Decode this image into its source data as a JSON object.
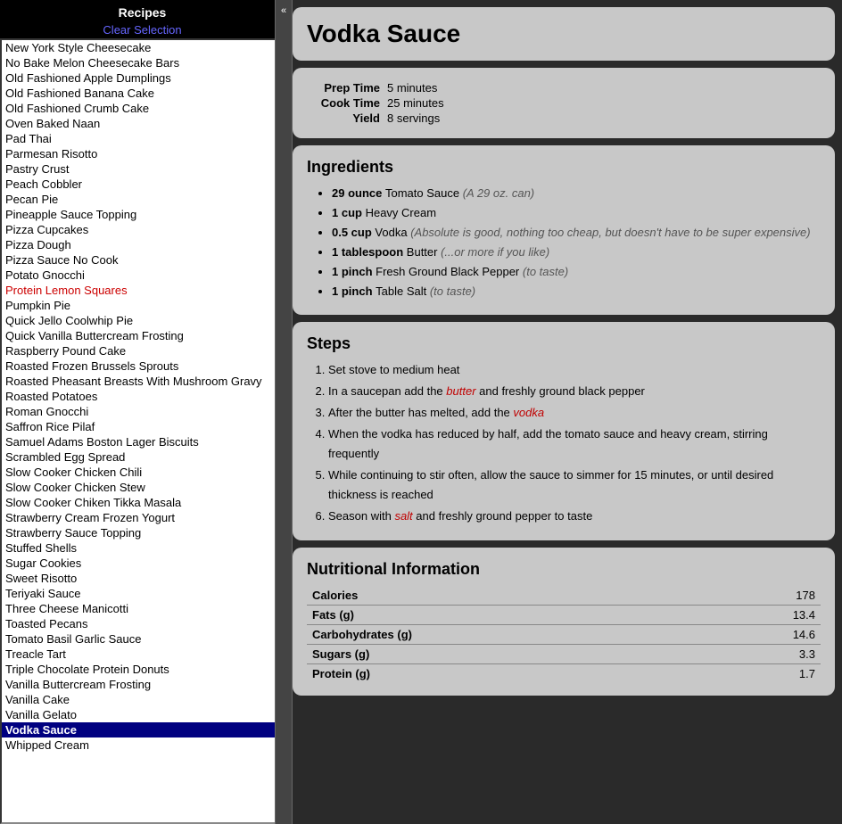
{
  "sidebar": {
    "title": "Recipes",
    "clear_label": "Clear Selection",
    "collapse_icon": "«",
    "recipes": [
      {
        "name": "New York Style Cheesecake",
        "selected": false,
        "red": false
      },
      {
        "name": "No Bake Melon Cheesecake Bars",
        "selected": false,
        "red": false
      },
      {
        "name": "Old Fashioned Apple Dumplings",
        "selected": false,
        "red": false
      },
      {
        "name": "Old Fashioned Banana Cake",
        "selected": false,
        "red": false
      },
      {
        "name": "Old Fashioned Crumb Cake",
        "selected": false,
        "red": false
      },
      {
        "name": "Oven Baked Naan",
        "selected": false,
        "red": false
      },
      {
        "name": "Pad Thai",
        "selected": false,
        "red": false
      },
      {
        "name": "Parmesan Risotto",
        "selected": false,
        "red": false
      },
      {
        "name": "Pastry Crust",
        "selected": false,
        "red": false
      },
      {
        "name": "Peach Cobbler",
        "selected": false,
        "red": false
      },
      {
        "name": "Pecan Pie",
        "selected": false,
        "red": false
      },
      {
        "name": "Pineapple Sauce Topping",
        "selected": false,
        "red": false
      },
      {
        "name": "Pizza Cupcakes",
        "selected": false,
        "red": false
      },
      {
        "name": "Pizza Dough",
        "selected": false,
        "red": false
      },
      {
        "name": "Pizza Sauce No Cook",
        "selected": false,
        "red": false
      },
      {
        "name": "Potato Gnocchi",
        "selected": false,
        "red": false
      },
      {
        "name": "Protein Lemon Squares",
        "selected": false,
        "red": true
      },
      {
        "name": "Pumpkin Pie",
        "selected": false,
        "red": false
      },
      {
        "name": "Quick Jello Coolwhip Pie",
        "selected": false,
        "red": false
      },
      {
        "name": "Quick Vanilla Buttercream Frosting",
        "selected": false,
        "red": false
      },
      {
        "name": "Raspberry Pound Cake",
        "selected": false,
        "red": false
      },
      {
        "name": "Roasted Frozen Brussels Sprouts",
        "selected": false,
        "red": false
      },
      {
        "name": "Roasted Pheasant Breasts With Mushroom Gravy",
        "selected": false,
        "red": false
      },
      {
        "name": "Roasted Potatoes",
        "selected": false,
        "red": false
      },
      {
        "name": "Roman Gnocchi",
        "selected": false,
        "red": false
      },
      {
        "name": "Saffron Rice Pilaf",
        "selected": false,
        "red": false
      },
      {
        "name": "Samuel Adams Boston Lager Biscuits",
        "selected": false,
        "red": false
      },
      {
        "name": "Scrambled Egg Spread",
        "selected": false,
        "red": false
      },
      {
        "name": "Slow Cooker Chicken Chili",
        "selected": false,
        "red": false
      },
      {
        "name": "Slow Cooker Chicken Stew",
        "selected": false,
        "red": false
      },
      {
        "name": "Slow Cooker Chiken Tikka Masala",
        "selected": false,
        "red": false
      },
      {
        "name": "Strawberry Cream Frozen Yogurt",
        "selected": false,
        "red": false
      },
      {
        "name": "Strawberry Sauce Topping",
        "selected": false,
        "red": false
      },
      {
        "name": "Stuffed Shells",
        "selected": false,
        "red": false
      },
      {
        "name": "Sugar Cookies",
        "selected": false,
        "red": false
      },
      {
        "name": "Sweet Risotto",
        "selected": false,
        "red": false
      },
      {
        "name": "Teriyaki Sauce",
        "selected": false,
        "red": false
      },
      {
        "name": "Three Cheese Manicotti",
        "selected": false,
        "red": false
      },
      {
        "name": "Toasted Pecans",
        "selected": false,
        "red": false
      },
      {
        "name": "Tomato Basil Garlic Sauce",
        "selected": false,
        "red": false
      },
      {
        "name": "Treacle Tart",
        "selected": false,
        "red": false
      },
      {
        "name": "Triple Chocolate Protein Donuts",
        "selected": false,
        "red": false
      },
      {
        "name": "Vanilla Buttercream Frosting",
        "selected": false,
        "red": false
      },
      {
        "name": "Vanilla Cake",
        "selected": false,
        "red": false
      },
      {
        "name": "Vanilla Gelato",
        "selected": false,
        "red": false
      },
      {
        "name": "Vodka Sauce",
        "selected": true,
        "red": false
      },
      {
        "name": "Whipped Cream",
        "selected": false,
        "red": false
      }
    ]
  },
  "recipe": {
    "title": "Vodka Sauce",
    "prep_time_label": "Prep Time",
    "prep_time": "5 minutes",
    "cook_time_label": "Cook Time",
    "cook_time": "25 minutes",
    "yield_label": "Yield",
    "yield": "8 servings",
    "ingredients_title": "Ingredients",
    "ingredients": [
      {
        "amount": "29 ounce",
        "name": "Tomato Sauce",
        "note": "(A 29 oz. can)"
      },
      {
        "amount": "1 cup",
        "name": "Heavy Cream",
        "note": ""
      },
      {
        "amount": "0.5 cup",
        "name": "Vodka",
        "note": "(Absolute is good, nothing too cheap, but doesn't have to be super expensive)"
      },
      {
        "amount": "1 tablespoon",
        "name": "Butter",
        "note": "(...or more if you like)"
      },
      {
        "amount": "1 pinch",
        "name": "Fresh Ground Black Pepper",
        "note": "(to taste)"
      },
      {
        "amount": "1 pinch",
        "name": "Table Salt",
        "note": "(to taste)"
      }
    ],
    "steps_title": "Steps",
    "steps": [
      {
        "text": "Set stove to medium heat",
        "highlight": ""
      },
      {
        "text": "In a saucepan add the ",
        "highlight": "butter",
        "after": " and freshly ground black pepper"
      },
      {
        "text": "After the butter has melted, add the ",
        "highlight": "vodka",
        "after": ""
      },
      {
        "text": "When the vodka has reduced by half, add the tomato sauce and heavy cream, stirring frequently",
        "highlight": "",
        "after": ""
      },
      {
        "text": "While continuing to stir often, allow the sauce to simmer for 15 minutes, or until desired thickness is reached",
        "highlight": "",
        "after": ""
      },
      {
        "text": "Season with ",
        "highlight": "salt",
        "after": " and freshly ground pepper to taste"
      }
    ],
    "nutrition_title": "Nutritional Information",
    "nutrition": [
      {
        "label": "Calories",
        "value": "178"
      },
      {
        "label": "Fats (g)",
        "value": "13.4"
      },
      {
        "label": "Carbohydrates (g)",
        "value": "14.6"
      },
      {
        "label": "Sugars (g)",
        "value": "3.3"
      },
      {
        "label": "Protein (g)",
        "value": "1.7"
      }
    ]
  }
}
